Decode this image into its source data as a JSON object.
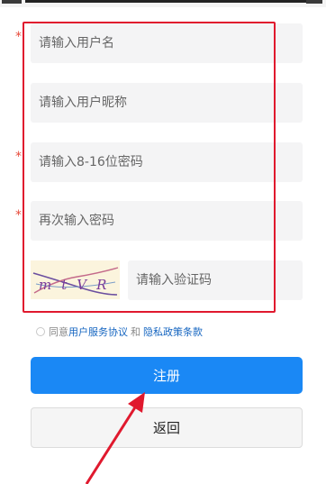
{
  "form": {
    "username": {
      "placeholder": "请输入用户名",
      "required": true
    },
    "nickname": {
      "placeholder": "请输入用户昵称",
      "required": false
    },
    "password": {
      "placeholder": "请输入8-16位密码",
      "required": true
    },
    "confirm_password": {
      "placeholder": "再次输入密码",
      "required": true
    },
    "captcha": {
      "placeholder": "请输入验证码",
      "image_text": "mtVR"
    },
    "required_marker": "*"
  },
  "agreement": {
    "prefix": "同意",
    "terms_link": "用户服务协议",
    "and": "和",
    "privacy_link": "隐私政策条款"
  },
  "buttons": {
    "register": "注册",
    "back": "返回"
  },
  "colors": {
    "primary": "#1a88f5",
    "highlight_border": "#e0192e",
    "annotation_arrow": "#e0192e",
    "link": "#1565c0",
    "required_star": "#e74c3c"
  },
  "annotations": {
    "highlight_box": "form-fields",
    "arrow_target": "register-button"
  }
}
